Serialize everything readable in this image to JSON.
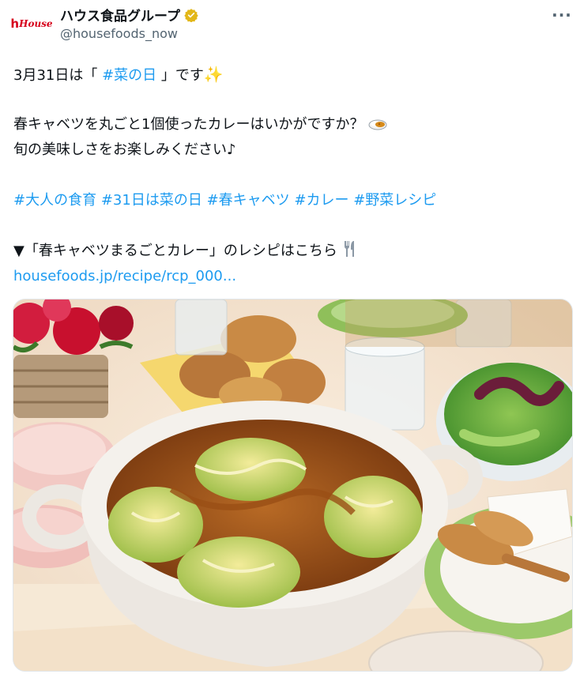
{
  "account": {
    "display_name": "ハウス食品グループ",
    "handle": "@housefoods_now",
    "logo_mark": "h",
    "logo_word": "House"
  },
  "tweet": {
    "line1_prefix": "3月31日は「 ",
    "line1_tag": "#菜の日",
    "line1_suffix": " 」です",
    "line2": "春キャベツを丸ごと1個使ったカレーはいかがですか？",
    "line3": "旬の美味しさをお楽しみください♪",
    "hashtags": [
      "#大人の食育",
      "#31日は菜の日",
      "#春キャベツ",
      "#カレー",
      "#野菜レシピ"
    ],
    "line5": "▼「春キャベツまるごとカレー」のレシピはこちら",
    "link": "housefoods.jp/recipe/rcp_000..."
  },
  "icons": {
    "verified": "verified-badge-icon",
    "more": "more-options-icon",
    "sparkle": "sparkles-icon",
    "curry": "curry-rice-icon",
    "cutlery": "fork-and-knife-icon"
  },
  "colors": {
    "link": "#1d9bf0",
    "text": "#0f1419",
    "secondary": "#536471",
    "brand_red": "#d6001c",
    "verified_gold": "#e2b719"
  }
}
